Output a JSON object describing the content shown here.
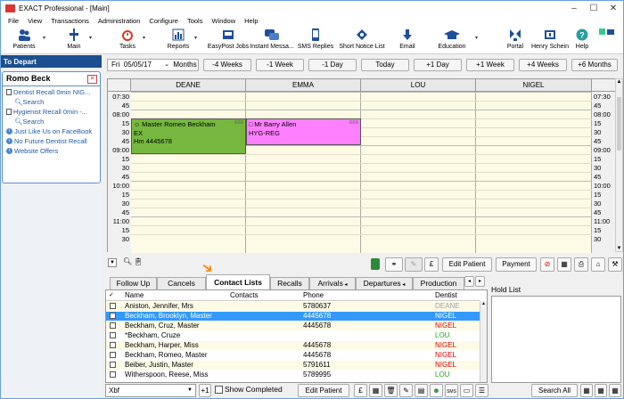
{
  "window": {
    "title": "EXACT Professional - [Main]",
    "minimize": "–",
    "maximize": "☐",
    "close": "✕"
  },
  "menu": [
    "File",
    "View",
    "Transactions",
    "Administration",
    "Configure",
    "Tools",
    "Window",
    "Help"
  ],
  "toolbar": [
    {
      "label": "Patients",
      "icon": "patients-icon"
    },
    {
      "label": "Main",
      "icon": "main-icon"
    },
    {
      "label": "Tasks",
      "icon": "tasks-icon"
    },
    {
      "label": "Reports",
      "icon": "reports-icon"
    },
    {
      "label": "EasyPost Jobs",
      "icon": "easypost-icon"
    },
    {
      "label": "Instant Messa...",
      "icon": "instant-message-icon"
    },
    {
      "label": "SMS Replies",
      "icon": "sms-icon"
    },
    {
      "label": "Short Notice List",
      "icon": "short-notice-icon"
    },
    {
      "label": "Email",
      "icon": "email-icon"
    },
    {
      "label": "Education",
      "icon": "education-icon"
    },
    {
      "label": "Portal",
      "icon": "portal-icon"
    },
    {
      "label": "Henry Schein",
      "icon": "henry-schein-icon"
    },
    {
      "label": "Help",
      "icon": "help-icon"
    }
  ],
  "left": {
    "header": "To Depart",
    "patient": "Romo Beck",
    "items": [
      {
        "text": "Dentist Recall 0min NIG...",
        "type": "doc"
      },
      {
        "text": "Search",
        "type": "search"
      },
      {
        "text": "Hygienist Recall 0min  -...",
        "type": "doc"
      },
      {
        "text": "Search",
        "type": "search"
      },
      {
        "text": "Just Like Us on FaceBook",
        "type": "info"
      },
      {
        "text": "No Future Dentist Recall",
        "type": "info"
      },
      {
        "text": "Website Offers",
        "type": "info"
      }
    ]
  },
  "schedule": {
    "day": "Fri",
    "date": "05/05/17",
    "nav": [
      "Months",
      "-4 Weeks",
      "-1 Week",
      "-1 Day",
      "Today",
      "+1 Day",
      "+1 Week",
      "+4 Weeks",
      "+6 Months"
    ],
    "providers": [
      "DEANE",
      "EMMA",
      "LOU",
      "NIGEL"
    ],
    "times": [
      "07:30",
      "45",
      "08:00",
      "15",
      "30",
      "45",
      "09:00",
      "15",
      "30",
      "45",
      "10:00",
      "15",
      "30",
      "45",
      "11:00",
      "15",
      "30"
    ],
    "appointments": [
      {
        "provider": "DEANE",
        "lines": [
          "Master Romeo Beckham",
          "EX",
          "Hm 4445678"
        ],
        "color": "#76b83f"
      },
      {
        "provider": "EMMA",
        "lines": [
          "Mr Barry Allen",
          "HYG-REG"
        ],
        "color": "#ff80ff"
      }
    ]
  },
  "actions": {
    "edit_patient": "Edit Patient",
    "payment": "Payment"
  },
  "tabs": [
    "Follow Up",
    "Cancels",
    "Contact Lists",
    "Recalls",
    "Arrivals",
    "Departures",
    "Production"
  ],
  "table": {
    "headers": [
      "Name",
      "Contacts",
      "Phone",
      "Dentist"
    ],
    "rows": [
      {
        "name": "Aniston, Jennifer, Mrs",
        "phone": "5780637",
        "dentist": "DEANE",
        "dcolor": "#a0a0a0",
        "selected": false,
        "alt": true
      },
      {
        "name": "Beckham, Brooklyn, Master",
        "phone": "4445678",
        "dentist": "NIGEL",
        "dcolor": "#ffffff",
        "selected": true,
        "alt": false
      },
      {
        "name": "Beckham, Cruz, Master",
        "phone": "4445678",
        "dentist": "NIGEL",
        "dcolor": "#e00000",
        "selected": false,
        "alt": true
      },
      {
        "name": "*Beckham, Cruze",
        "phone": "",
        "dentist": "LOU",
        "dcolor": "#22aa22",
        "selected": false,
        "alt": false
      },
      {
        "name": "Beckham, Harper, Miss",
        "phone": "4445678",
        "dentist": "NIGEL",
        "dcolor": "#e00000",
        "selected": false,
        "alt": true
      },
      {
        "name": "Beckham, Romeo, Master",
        "phone": "4445678",
        "dentist": "NIGEL",
        "dcolor": "#e00000",
        "selected": false,
        "alt": false
      },
      {
        "name": "Beiber, Justin, Master",
        "phone": "5791611",
        "dentist": "NIGEL",
        "dcolor": "#e00000",
        "selected": false,
        "alt": true
      },
      {
        "name": "Witherspoon, Reese, Miss",
        "phone": "5789995",
        "dentist": "LOU",
        "dcolor": "#22aa22",
        "selected": false,
        "alt": false
      }
    ]
  },
  "hold_list": {
    "title": "Hold List"
  },
  "bottombar": {
    "filter": "Xbf",
    "show_completed": "Show Completed",
    "edit_patient": "Edit Patient",
    "search_all": "Search All"
  }
}
